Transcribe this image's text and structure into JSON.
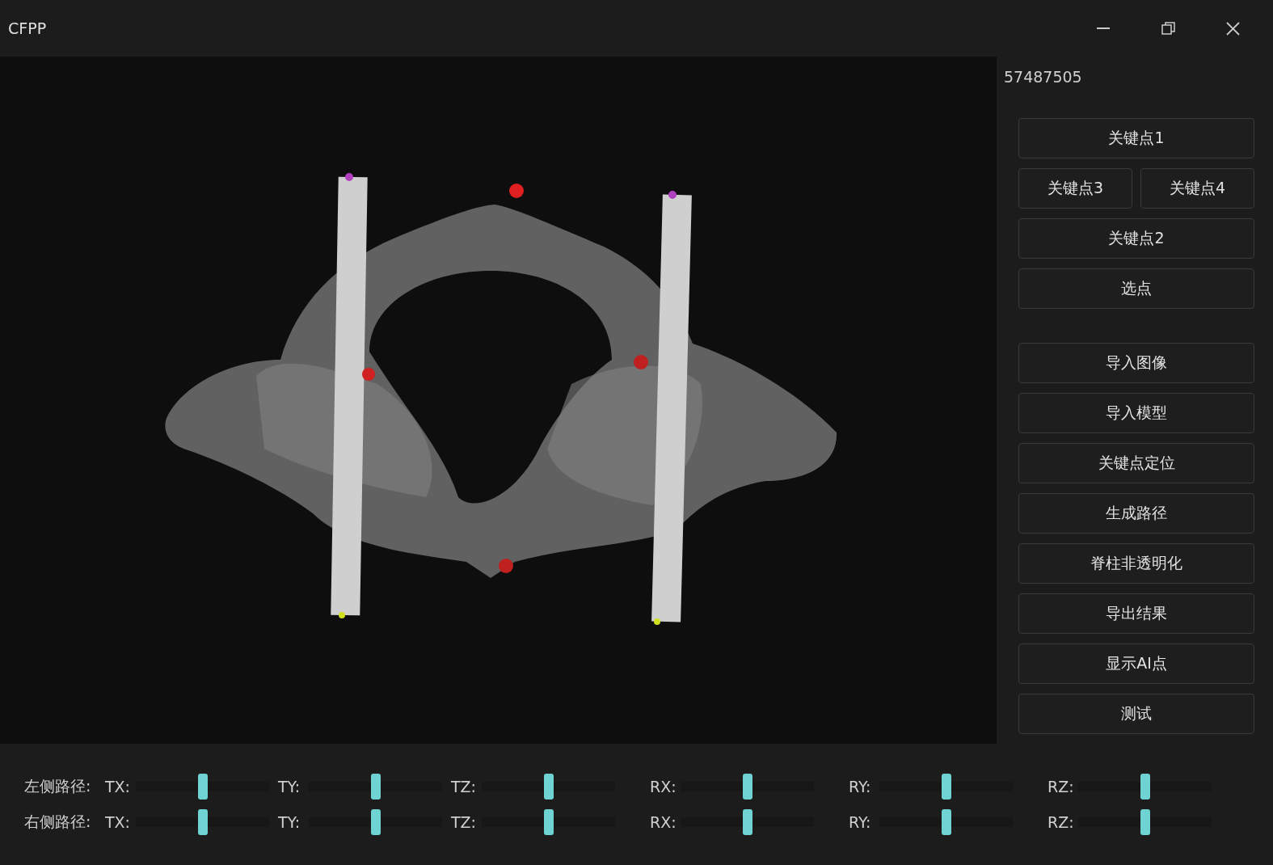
{
  "window": {
    "title": "CFPP"
  },
  "panel": {
    "case_id": "57487505",
    "keypoint_rows": [
      [
        "关键点1"
      ],
      [
        "关键点3",
        "关键点4"
      ],
      [
        "关键点2"
      ],
      [
        "选点"
      ]
    ],
    "actions": [
      "导入图像",
      "导入模型",
      "关键点定位",
      "生成路径",
      "脊柱非透明化",
      "导出结果",
      "显示AI点",
      "测试"
    ]
  },
  "paths": [
    {
      "label": "左侧路径:",
      "sliders": [
        {
          "label": "TX:",
          "level": 0.5
        },
        {
          "label": "TY:",
          "level": 0.5
        },
        {
          "label": "TZ:",
          "level": 0.5
        },
        {
          "label": "RX:",
          "level": 0.5
        },
        {
          "label": "RY:",
          "level": 0.5
        },
        {
          "label": "RZ:",
          "level": 0.5
        }
      ]
    },
    {
      "label": "右侧路径:",
      "sliders": [
        {
          "label": "TX:",
          "level": 0.5
        },
        {
          "label": "TY:",
          "level": 0.5
        },
        {
          "label": "TZ:",
          "level": 0.5
        },
        {
          "label": "RX:",
          "level": 0.5
        },
        {
          "label": "RY:",
          "level": 0.5
        },
        {
          "label": "RZ:",
          "level": 0.5
        }
      ]
    }
  ]
}
